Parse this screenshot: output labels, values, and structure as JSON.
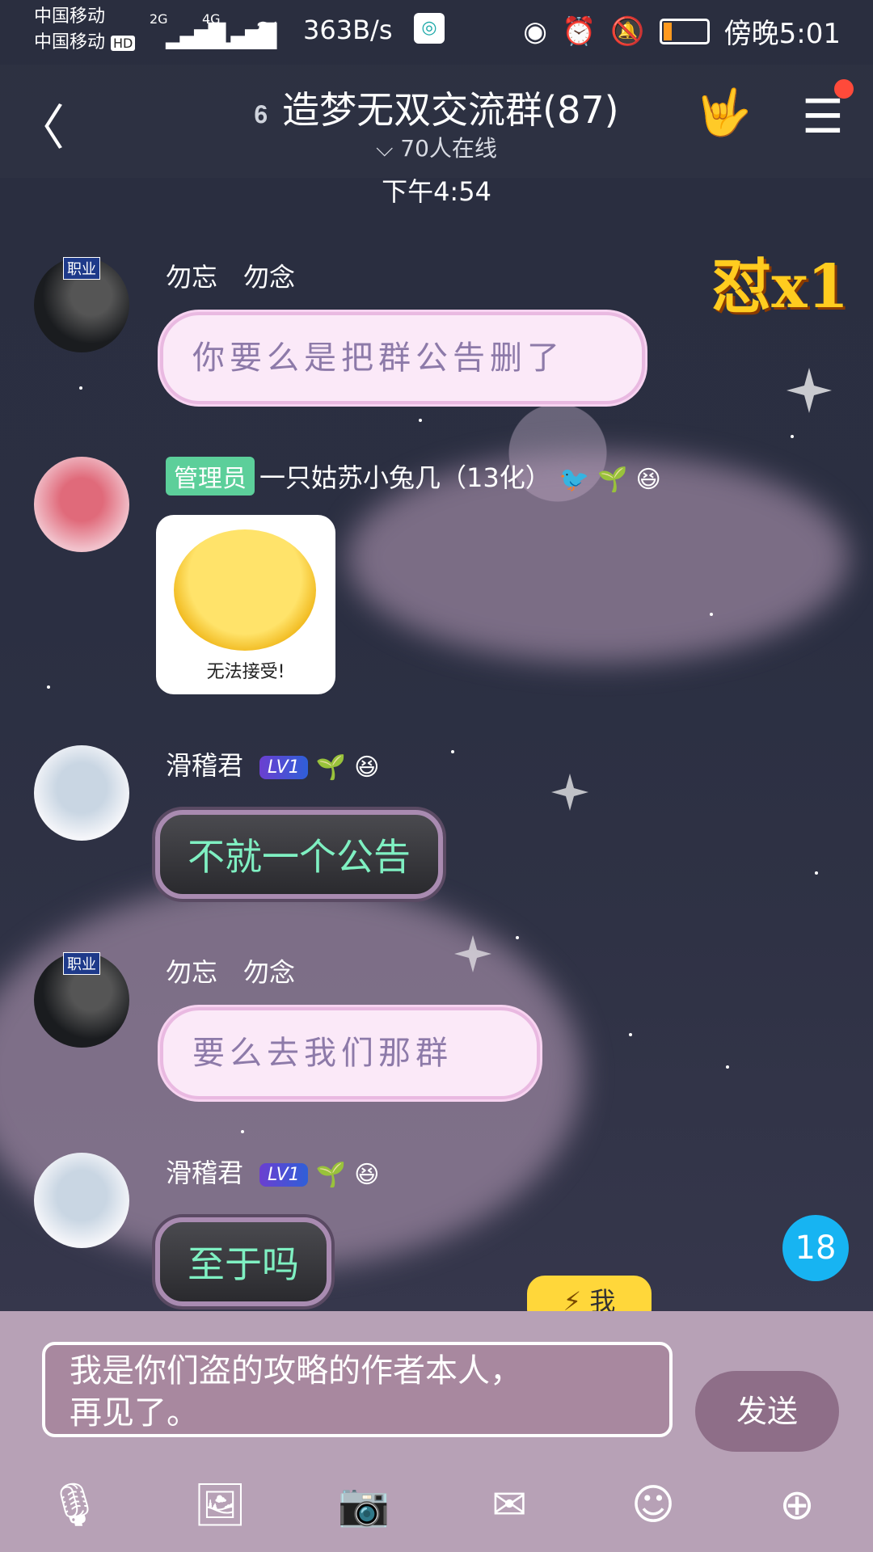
{
  "status": {
    "carrier1": "中国移动",
    "carrier2": "中国移动",
    "carrier2_badge": "HD",
    "network_left": "2G",
    "network_right": "4G",
    "speed": "363B/s",
    "time": "傍晚5:01"
  },
  "header": {
    "title": "造梦无双交流群(87)",
    "online": "70人在线"
  },
  "timestamp": "下午4:54",
  "messages": [
    {
      "job_badge": "职业",
      "nick": "勿忘　勿念",
      "text": "你要么是把群公告删了"
    },
    {
      "admin": "管理员",
      "nick": "一只姑苏小兔几（13化）",
      "sticker_caption": "无法接受!"
    },
    {
      "nick": "滑稽君",
      "level": "LV1",
      "text": "不就一个公告"
    },
    {
      "job_badge": "职业",
      "nick": "勿忘　勿念",
      "text": "要么去我们那群"
    },
    {
      "nick": "滑稽君",
      "level": "LV1",
      "text": "至于吗"
    }
  ],
  "combo": "怼x1",
  "unread_count": "18",
  "me_button": "我",
  "input_text_line1": "我是你们盗的攻略的作者本人，",
  "input_text_line2": "再见了。",
  "send_label": "发送",
  "colors": {
    "admin_badge": "#5ccf9a",
    "unread": "#17b4f2",
    "me_pill": "#ffd73a",
    "input_bg": "#b7a1b6"
  }
}
